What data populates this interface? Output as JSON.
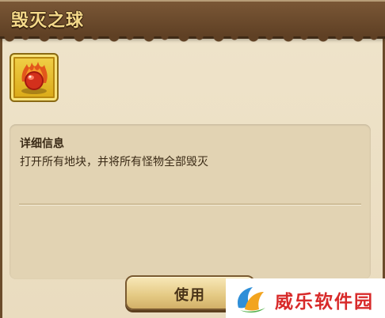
{
  "header": {
    "title": "毁灭之球"
  },
  "item": {
    "icon": "fire-orb-icon",
    "slot_color": "#e8be2a"
  },
  "info": {
    "label": "详细信息",
    "description": "打开所有地块，并将所有怪物全部毁灭"
  },
  "actions": {
    "use_label": "使用"
  },
  "watermark": {
    "text": "威乐软件园",
    "icon": "leaf-logo-icon",
    "color": "#d82a2a"
  }
}
